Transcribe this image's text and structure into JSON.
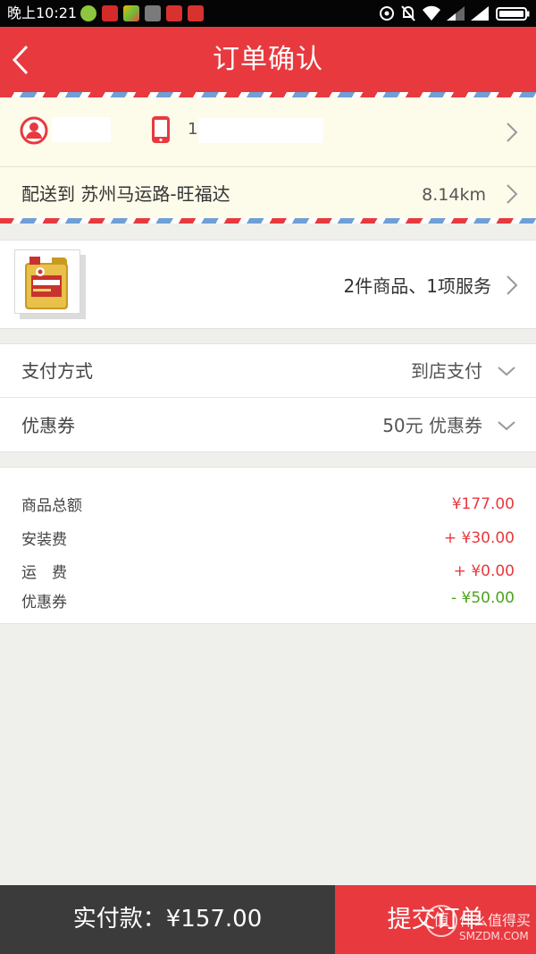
{
  "status_bar": {
    "time": "晚上10:21",
    "left_icons": [
      "app-notification-icon",
      "app-notification-icon",
      "app-notification-icon",
      "app-notification-icon",
      "app-notification-icon",
      "app-notification-icon"
    ],
    "right_icons": [
      "hotspot-icon",
      "mute-icon",
      "wifi-icon",
      "signal-icon",
      "signal-icon",
      "battery-icon"
    ]
  },
  "header": {
    "title": "订单确认",
    "back_icon": "chevron-left-icon"
  },
  "colors": {
    "brand_red": "#e8393f",
    "discount_green": "#4aa51c",
    "cream": "#fdfbea",
    "page_gray": "#efefeb",
    "footer_dark": "#3b3b3b",
    "stripe_blue": "#6f9fd6"
  },
  "contact": {
    "user_icon": "user-icon",
    "phone_icon": "phone-icon",
    "phone": "1"
  },
  "delivery": {
    "label": "配送到",
    "address": "苏州马运路-旺福达",
    "distance": "8.14km"
  },
  "products": {
    "summary": "2件商品、1项服务"
  },
  "payment": {
    "method_label": "支付方式",
    "method_value": "到店支付",
    "coupon_label": "优惠券",
    "coupon_value": "50元 优惠券"
  },
  "summary": {
    "rows": [
      {
        "label": "商品总额",
        "value": "¥177.00"
      },
      {
        "label": "安装费",
        "value": "+ ¥30.00"
      },
      {
        "label": "运　费",
        "value": "+ ¥0.00"
      },
      {
        "label": "优惠券",
        "value": "- ¥50.00"
      }
    ]
  },
  "footer": {
    "total_label": "实付款：",
    "total_value": "¥157.00",
    "submit_label": "提交订单"
  },
  "watermark": {
    "logo_char": "值",
    "text": "什么值得买",
    "url": "SMZDM.COM"
  }
}
